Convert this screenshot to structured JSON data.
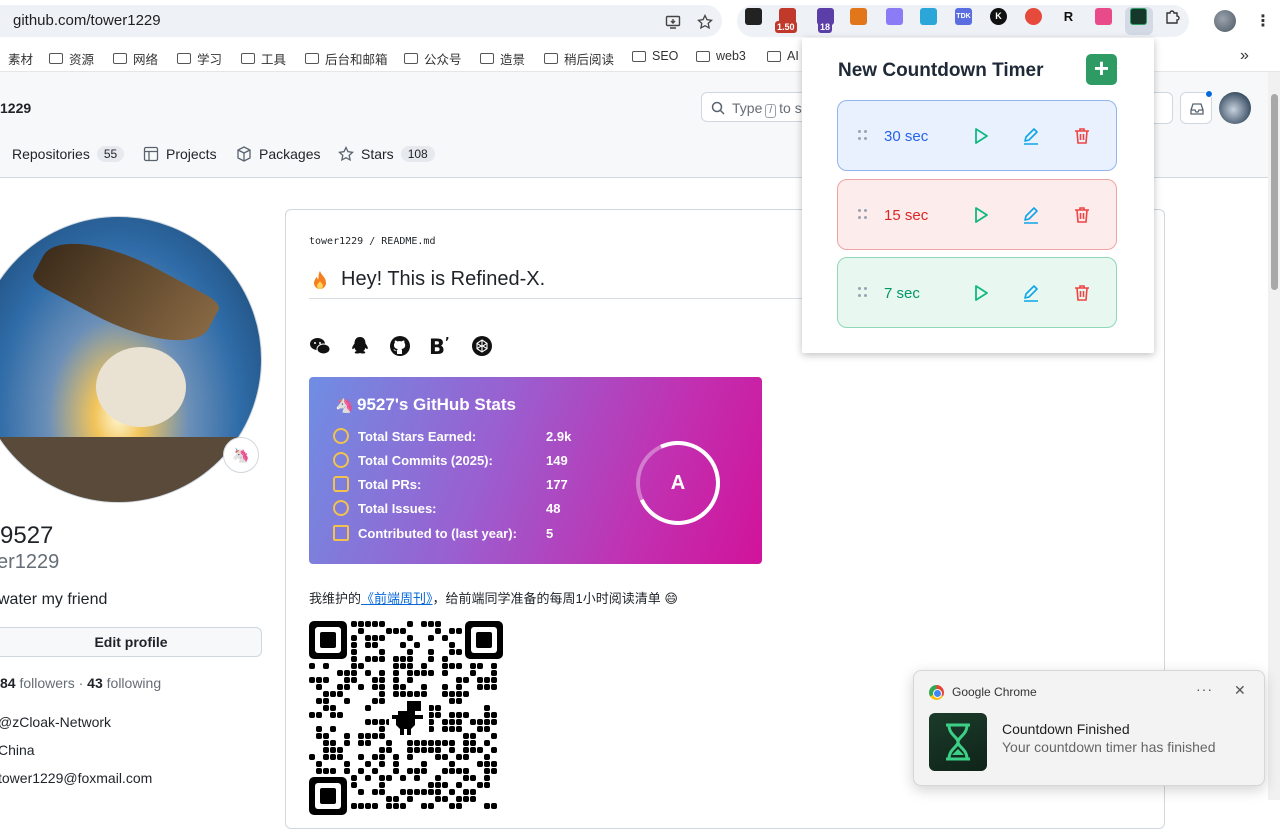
{
  "browser": {
    "url": "github.com/tower1229",
    "bookmarks": [
      "素材",
      "资源",
      "网络",
      "学习",
      "工具",
      "后台和邮箱",
      "公众号",
      "造景",
      "稍后阅读",
      "SEO",
      "web3",
      "AI"
    ],
    "extension_badges": {
      "price": "1.50",
      "count": "18"
    },
    "ext_labels": {
      "tdk": "TDK",
      "k": "K",
      "r": "R"
    }
  },
  "github": {
    "header_user": "1229",
    "search": {
      "label": "Type",
      "key": "/",
      "suffix": "to s"
    },
    "tabs": [
      {
        "label": "Repositories",
        "count": "55"
      },
      {
        "label": "Projects"
      },
      {
        "label": "Packages"
      },
      {
        "label": "Stars",
        "count": "108"
      }
    ],
    "profile": {
      "name": "9527",
      "login": "er1229",
      "bio": "water my friend",
      "edit_label": "Edit profile",
      "followers_count": "84",
      "followers_label": "followers",
      "dot": "·",
      "following_count": "43",
      "following_label": "following",
      "org": "@zCloak-Network",
      "location": "China",
      "email": "tower1229@foxmail.com"
    },
    "readme": {
      "crumb_user": "tower1229",
      "crumb_sep": "/",
      "crumb_file": "README.md",
      "heading": "Hey! This is Refined-X.",
      "weekly_prefix": "我维护的",
      "weekly_link": "《前端周刊》",
      "weekly_suffix": "，给前端同学准备的每周1小时阅读清单 😄"
    },
    "stats_card": {
      "title": "9527's GitHub Stats",
      "rows": [
        {
          "label": "Total Stars Earned:",
          "value": "2.9k"
        },
        {
          "label": "Total Commits (2025):",
          "value": "149"
        },
        {
          "label": "Total PRs:",
          "value": "177"
        },
        {
          "label": "Total Issues:",
          "value": "48"
        },
        {
          "label": "Contributed to (last year):",
          "value": "5"
        }
      ],
      "grade": "A"
    }
  },
  "popup": {
    "title": "New Countdown Timer",
    "add_label": "+",
    "timers": [
      {
        "label": "30 sec",
        "bg": "#eaf1fe",
        "border": "#93b4ee",
        "text": "#2563eb"
      },
      {
        "label": "15 sec",
        "bg": "#fdecec",
        "border": "#f0a3a3",
        "text": "#dc2626"
      },
      {
        "label": "7 sec",
        "bg": "#e8f7f0",
        "border": "#8fd8b8",
        "text": "#059669"
      }
    ],
    "colors": {
      "play": "#10b981",
      "edit": "#0ea5e9",
      "delete": "#ef4444"
    }
  },
  "notification": {
    "app": "Google Chrome",
    "more": "···",
    "close": "✕",
    "title": "Countdown Finished",
    "body": "Your countdown timer has finished"
  }
}
